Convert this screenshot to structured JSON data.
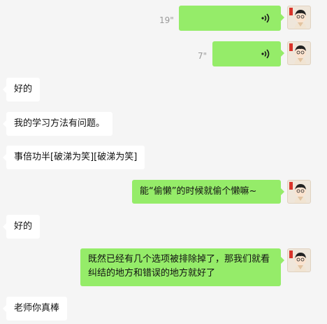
{
  "messages": [
    {
      "side": "right",
      "type": "voice",
      "duration": "19\""
    },
    {
      "side": "right",
      "type": "voice",
      "duration": "7\""
    },
    {
      "side": "left",
      "type": "text",
      "text": "好的"
    },
    {
      "side": "left",
      "type": "text",
      "text": "我的学习方法有问题。"
    },
    {
      "side": "left",
      "type": "text",
      "text": "事倍功半[破涕为笑][破涕为笑]"
    },
    {
      "side": "right",
      "type": "text",
      "text": "能“偷懒”的时候就偷个懒嘛~"
    },
    {
      "side": "left",
      "type": "text",
      "text": "好的"
    },
    {
      "side": "right",
      "type": "text",
      "text": "既然已经有几个选项被排除掉了，那我们就看纠结的地方和错误的地方就好了"
    },
    {
      "side": "left",
      "type": "text",
      "text": "老师你真棒"
    }
  ],
  "colors": {
    "background": "#f5f5f5",
    "sent_bubble": "#95ec69",
    "received_bubble": "#ffffff",
    "duration_text": "#9a9a9a"
  },
  "icons": {
    "voice": "voice-wave-icon",
    "avatar": "cartoon-avatar"
  }
}
